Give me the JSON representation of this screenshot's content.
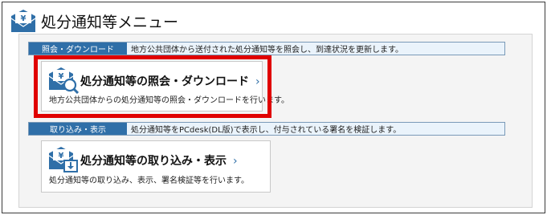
{
  "header": {
    "title": "処分通知等メニュー",
    "icon": "mail-yen-icon"
  },
  "sections": [
    {
      "label": "照会・ダウンロード",
      "description": "地方公共団体から送付された処分通知等を照会し、到達状況を更新します。",
      "card": {
        "title": "処分通知等の照会・ダウンロード",
        "chevron": "›",
        "description": "地方公共団体からの処分通知等の照会・ダウンロードを行います。",
        "icon": "mail-yen-search-icon",
        "highlighted": true
      }
    },
    {
      "label": "取り込み・表示",
      "description": "処分通知等をPCdesk(DL版)で表示し、付与されている署名を検証します。",
      "card": {
        "title": "処分通知等の取り込み・表示",
        "chevron": "›",
        "description": "処分通知等の取り込み、表示、署名検証等を行います。",
        "icon": "mail-yen-import-icon",
        "highlighted": false
      }
    }
  ],
  "colors": {
    "accent": "#2f6fa8",
    "highlight": "#e00000"
  }
}
